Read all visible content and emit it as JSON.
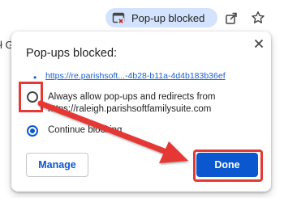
{
  "browser": {
    "popup_chip_label": "Pop-up blocked",
    "popup_chip_icon": "popup-blocked-icon",
    "toolbar_icons": [
      "share-icon",
      "star-icon"
    ],
    "bg_left_text": "ł G"
  },
  "dialog": {
    "title": "Pop-ups blocked:",
    "close_icon": "close-icon",
    "blocked_link": "https://re.parishsoft...-4b28-b11a-4d4b183b36ef",
    "option_allow_label": "Always allow pop-ups and redirects from https://raleigh.parishsoftfamilysuite.com",
    "option_allow_selected": false,
    "option_block_label": "Continue blocking",
    "option_block_selected": true,
    "manage_label": "Manage",
    "done_label": "Done"
  },
  "annotations": {
    "highlight_color": "#e53935",
    "arrow_color": "#e53935"
  },
  "colors": {
    "accent": "#0b57d0",
    "chip_bg": "#d3e3fd"
  }
}
